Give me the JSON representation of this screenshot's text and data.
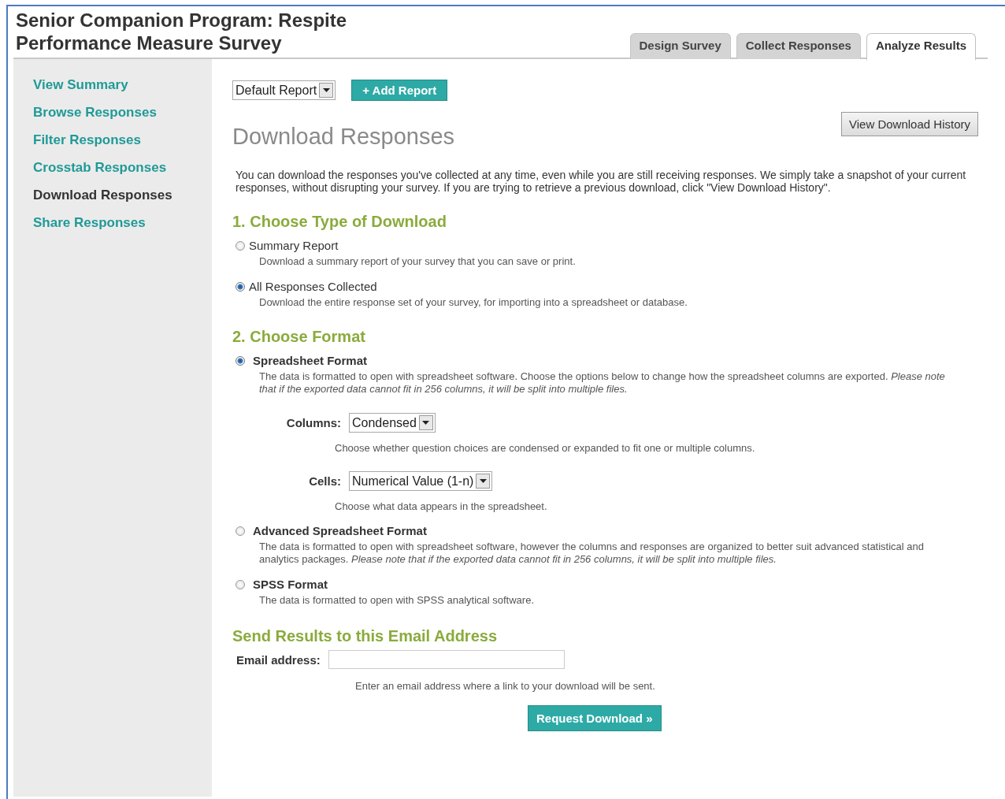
{
  "title": "Senior Companion Program: Respite Performance Measure Survey",
  "tabs": [
    {
      "label": "Design Survey",
      "selected": false
    },
    {
      "label": "Collect Responses",
      "selected": false
    },
    {
      "label": "Analyze Results",
      "selected": true
    }
  ],
  "sidebar": {
    "items": [
      {
        "label": "View Summary",
        "selected": false
      },
      {
        "label": "Browse Responses",
        "selected": false
      },
      {
        "label": "Filter Responses",
        "selected": false
      },
      {
        "label": "Crosstab Responses",
        "selected": false
      },
      {
        "label": "Download Responses",
        "selected": true
      },
      {
        "label": "Share Responses",
        "selected": false
      }
    ]
  },
  "report_select": {
    "value": "Default Report"
  },
  "add_report_button": "+ Add Report",
  "heading": "Download Responses",
  "history_button": "View Download History",
  "intro": "You can download the responses you've collected at any time, even while you are still receiving responses. We simply take a snapshot of your current responses, without disrupting your survey. If you are trying to retrieve a previous download, click \"View Download History\".",
  "sections": [
    {
      "kind": "type",
      "heading": "1. Choose Type of Download",
      "options": [
        {
          "label": "Summary Report",
          "selected": false,
          "description": "Download a summary report of your survey that you can save or print."
        },
        {
          "label": "All Responses Collected",
          "selected": true,
          "description": "Download the entire response set of your survey, for importing into a spreadsheet or database."
        }
      ]
    },
    {
      "kind": "format",
      "heading": "2. Choose Format",
      "options": [
        {
          "label": "Spreadsheet Format",
          "selected": true,
          "description": "The data is formatted to open with spreadsheet software. Choose the options below to change how the spreadsheet columns are exported. *Please note that if the exported data cannot fit in 256 columns, it will be split into multiple files.*",
          "settings": [
            {
              "label": "Columns:",
              "value": "Condensed",
              "hint": "Choose whether question choices are condensed or expanded to fit one or multiple columns."
            },
            {
              "label": "Cells:",
              "value": "Numerical Value (1-n)",
              "hint": "Choose what data appears in the spreadsheet."
            }
          ]
        },
        {
          "label": "Advanced Spreadsheet Format",
          "selected": false,
          "description": "The data is formatted to open with spreadsheet software, however the columns and responses are organized to better suit advanced statistical and analytics packages. *Please note that if the exported data cannot fit in 256 columns, it will be split into multiple files.*"
        },
        {
          "label": "SPSS Format",
          "selected": false,
          "description": "The data is formatted to open with SPSS analytical software."
        }
      ]
    }
  ],
  "email": {
    "heading": "Send Results to this Email Address",
    "label": "Email address:",
    "hint": "Enter an email address where a link to your download will be sent.",
    "button": "Request Download »"
  }
}
